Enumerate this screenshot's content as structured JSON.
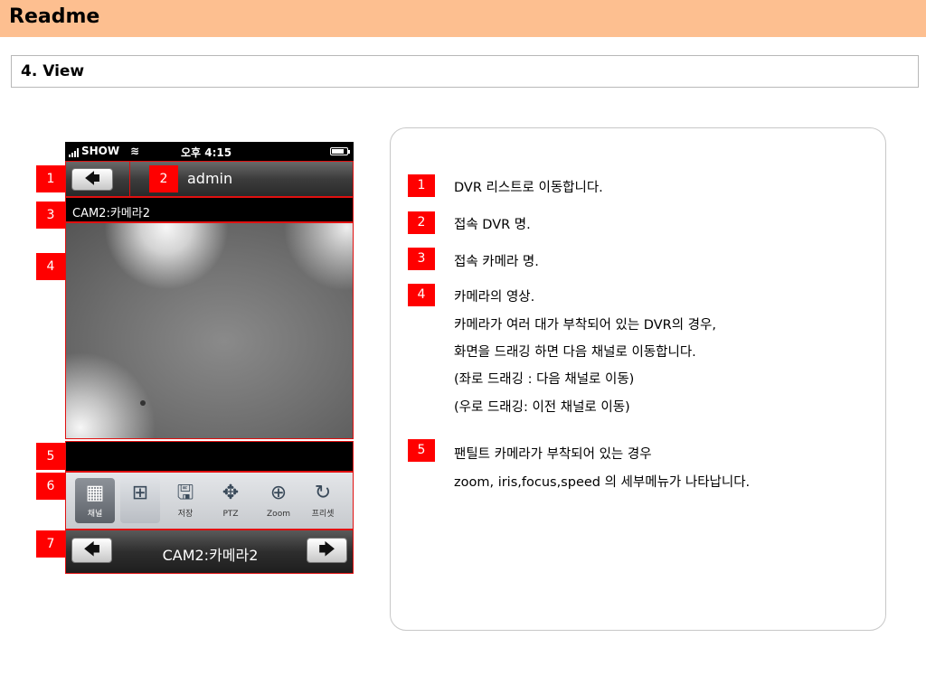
{
  "header": {
    "title": "Readme"
  },
  "section": {
    "title": "4. View"
  },
  "phone": {
    "status_bar": {
      "carrier": "SHOW",
      "time": "오후 4:15"
    },
    "nav": {
      "back_glyph": "🡄",
      "title": "admin"
    },
    "camera_label": "CAM2:카메라2",
    "toolbar": {
      "items": [
        {
          "icon": "grid-9-icon",
          "glyph": "▦",
          "label": "채널"
        },
        {
          "icon": "grid-4-icon",
          "glyph": "⊞",
          "label": ""
        },
        {
          "icon": "save-icon",
          "glyph": "🖫",
          "label": "저장"
        },
        {
          "icon": "ptz-move-icon",
          "glyph": "✥",
          "label": "PTZ"
        },
        {
          "icon": "zoom-icon",
          "glyph": "⊕",
          "label": "Zoom"
        },
        {
          "icon": "preset-icon",
          "glyph": "↻",
          "label": "프리셋"
        }
      ]
    },
    "camera_nav": {
      "prev_glyph": "🡄",
      "next_glyph": "🡆",
      "camera_name": "CAM2:카메라2"
    }
  },
  "markers": {
    "left": [
      "1",
      "2",
      "3",
      "4",
      "5",
      "6",
      "7"
    ],
    "right": [
      "1",
      "2",
      "3",
      "4",
      "5"
    ]
  },
  "descriptions": {
    "item1": "DVR 리스트로 이동합니다.",
    "item2": "접속 DVR 명.",
    "item3": "접속 카메라 명.",
    "item4": [
      "카메라의 영상.",
      "카메라가 여러 대가 부착되어 있는 DVR의 경우,",
      "화면을 드래깅 하면 다음 채널로 이동합니다.",
      "(좌로 드래깅 : 다음 채널로 이동)",
      "(우로 드래깅: 이전 채널로 이동)"
    ],
    "item5": [
      "팬틸트 카메라가 부착되어 있는 경우",
      "zoom, iris,focus,speed 의 세부메뉴가 나타납니다."
    ]
  },
  "colors": {
    "title_bar": "#fdbf90",
    "marker": "#ff0000",
    "highlight_border": "#e01010"
  }
}
